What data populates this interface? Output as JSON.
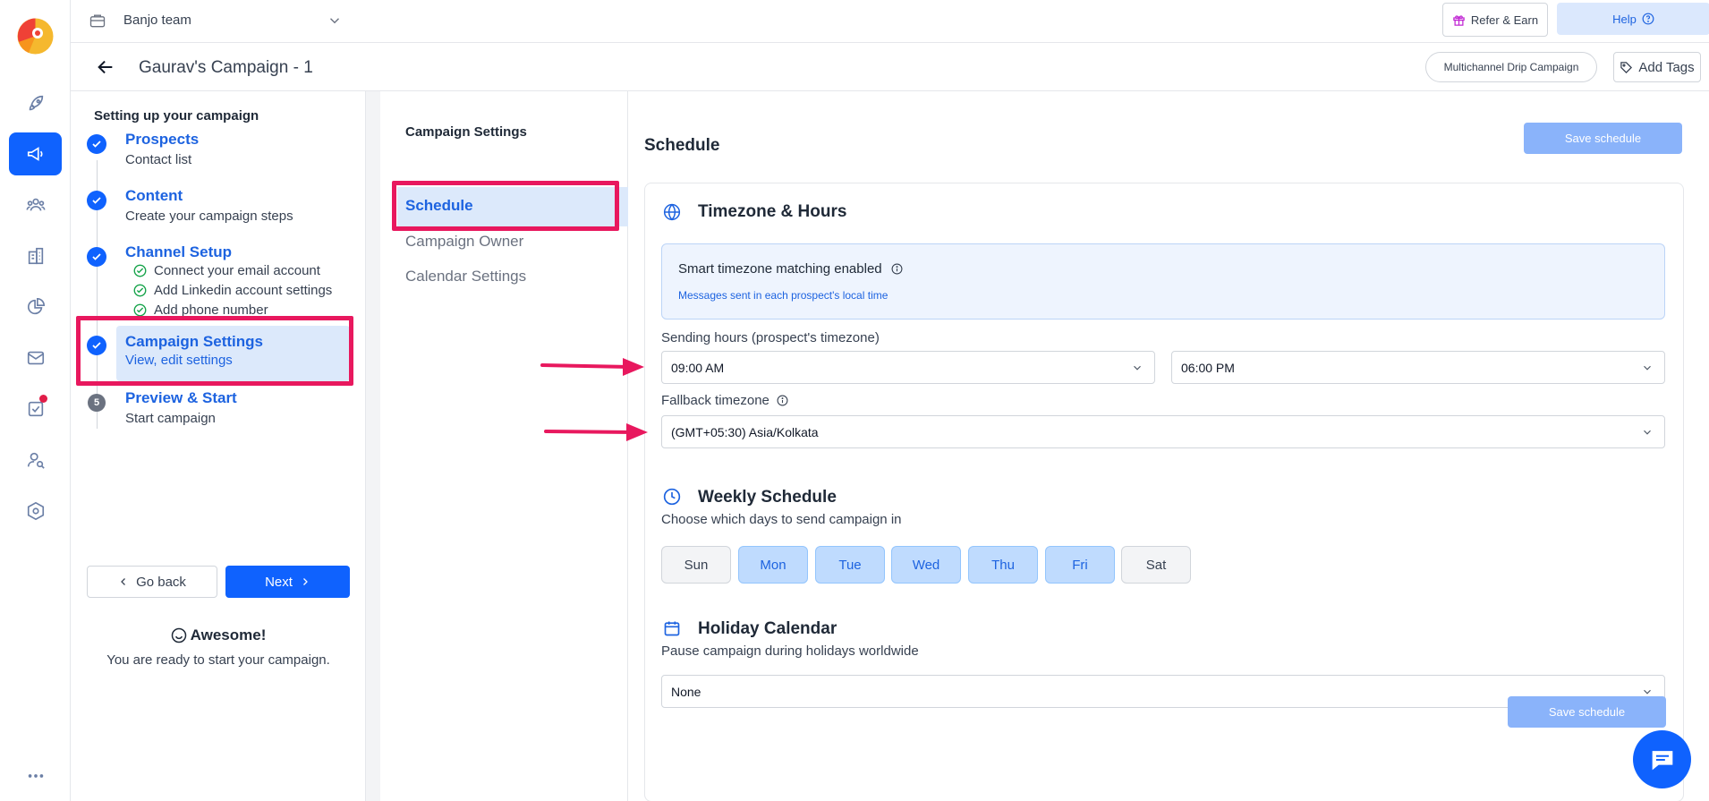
{
  "header": {
    "team_name": "Banjo team",
    "refer_label": "Refer & Earn",
    "help_label": "Help"
  },
  "campaign": {
    "title": "Gaurav's Campaign - 1",
    "type_pill": "Multichannel Drip Campaign",
    "add_tags_label": "Add Tags"
  },
  "sidebar": {
    "icons": [
      "rocket-icon",
      "megaphone-icon",
      "team-icon",
      "building-icon",
      "pie-chart-icon",
      "mail-icon",
      "task-icon",
      "user-search-icon",
      "settings-hex-icon",
      "more-icon"
    ],
    "active_index": 1,
    "brand_color": "#0f62fe"
  },
  "steps": {
    "title": "Setting up your campaign",
    "items": [
      {
        "name": "Prospects",
        "sub": "Contact list",
        "status": "done"
      },
      {
        "name": "Content",
        "sub": "Create your campaign steps",
        "status": "done"
      },
      {
        "name": "Channel Setup",
        "status": "done",
        "subitems": [
          "Connect your email account",
          "Add Linkedin account settings",
          "Add phone number"
        ]
      },
      {
        "name": "Campaign Settings",
        "sub": "View, edit settings",
        "status": "active"
      },
      {
        "name": "Preview & Start",
        "sub": "Start campaign",
        "status": "pending",
        "number": "5"
      }
    ],
    "go_back_label": "Go back",
    "next_label": "Next",
    "awesome_title": "Awesome!",
    "awesome_text": "You are ready to start your campaign."
  },
  "settings_nav": {
    "title": "Campaign Settings",
    "items": [
      "Schedule",
      "Campaign Owner",
      "Calendar Settings"
    ],
    "active": "Schedule"
  },
  "schedule": {
    "title": "Schedule",
    "save_label": "Save schedule",
    "timezone": {
      "title": "Timezone & Hours",
      "info_title": "Smart timezone matching enabled",
      "info_sub": "Messages sent in each prospect's local time",
      "sending_hours_label": "Sending hours (prospect's timezone)",
      "start_time": "09:00 AM",
      "end_time": "06:00 PM",
      "fallback_label": "Fallback timezone",
      "fallback_value": "(GMT+05:30) Asia/Kolkata"
    },
    "weekly": {
      "title": "Weekly Schedule",
      "subtitle": "Choose which days to send campaign in",
      "days": [
        {
          "label": "Sun",
          "selected": false
        },
        {
          "label": "Mon",
          "selected": true
        },
        {
          "label": "Tue",
          "selected": true
        },
        {
          "label": "Wed",
          "selected": true
        },
        {
          "label": "Thu",
          "selected": true
        },
        {
          "label": "Fri",
          "selected": true
        },
        {
          "label": "Sat",
          "selected": false
        }
      ]
    },
    "holiday": {
      "title": "Holiday Calendar",
      "subtitle": "Pause campaign during holidays worldwide",
      "value": "None"
    }
  },
  "annotations": {
    "highlight_color": "#e8185e"
  }
}
